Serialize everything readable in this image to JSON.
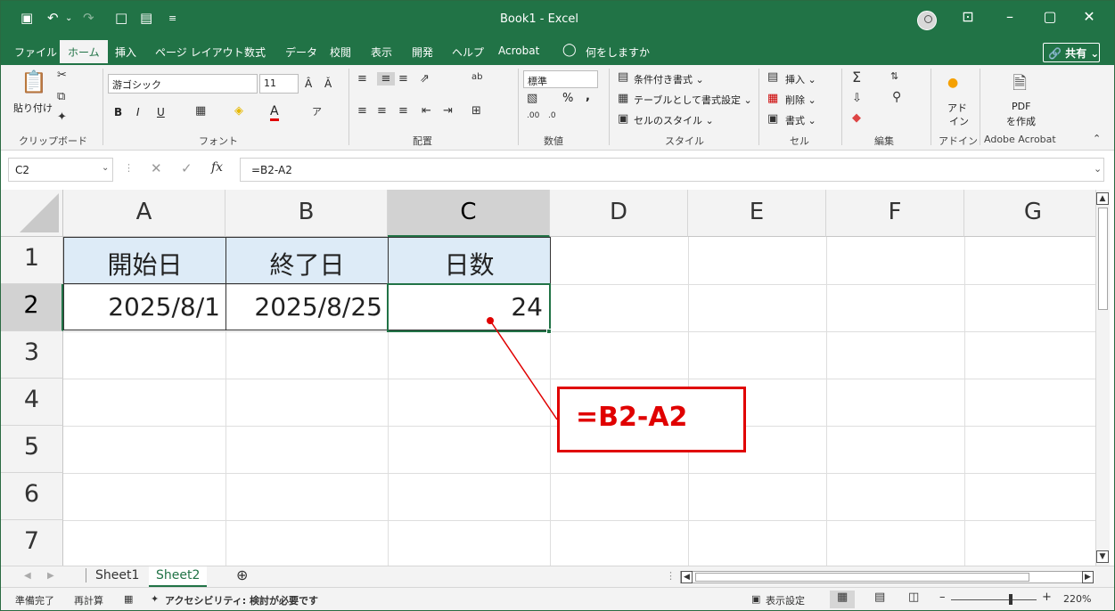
{
  "titlebar": {
    "title": "Book1  -  Excel",
    "qat": [
      "💾",
      "↶",
      "↷",
      "🗋",
      "▦",
      "="
    ],
    "minimize": "–",
    "restore": "▢",
    "close": "✕",
    "ribbon_display": "⊡"
  },
  "tabs": [
    "ファイル",
    "ホーム",
    "挿入",
    "ページ レイアウト",
    "数式",
    "データ",
    "校閲",
    "表示",
    "開発",
    "ヘルプ",
    "Acrobat"
  ],
  "tellme": "何をしますか",
  "share_label": "🔗 共有 ⌄",
  "ribbon": {
    "clipboard": {
      "paste": "貼り付け",
      "group": "クリップボード"
    },
    "font": {
      "name": "游ゴシック",
      "size": "11",
      "group": "フォント",
      "bold": "B",
      "italic": "I",
      "underline": "U",
      "grow": "A^",
      "shrink": "A˅"
    },
    "alignment": {
      "group": "配置"
    },
    "number": {
      "format": "標準",
      "percent": "%",
      "comma": ",",
      "group": "数値"
    },
    "styles": {
      "conditional": "条件付き書式 ⌄",
      "table": "テーブルとして書式設定 ⌄",
      "cellstyle": "セルのスタイル ⌄",
      "group": "スタイル"
    },
    "cells": {
      "insert": "挿入 ⌄",
      "delete": "削除 ⌄",
      "format": "書式 ⌄",
      "group": "セル"
    },
    "editing": {
      "group": "編集"
    },
    "addins": {
      "label1": "アド",
      "label2": "イン",
      "group": "アドイン"
    },
    "acrobat": {
      "label1": "PDF",
      "label2": "を作成",
      "group": "Adobe Acrobat"
    }
  },
  "formula_bar": {
    "name_box": "C2",
    "cancel": "✕",
    "enter": "✓",
    "fx": "fx",
    "formula": "=B2-A2"
  },
  "columns": [
    "A",
    "B",
    "C",
    "D",
    "E",
    "F",
    "G"
  ],
  "rows": [
    "1",
    "2",
    "3",
    "4",
    "5",
    "6",
    "7"
  ],
  "cells": {
    "A1": "開始日",
    "B1": "終了日",
    "C1": "日数",
    "A2": "2025/8/1",
    "B2": "2025/8/25",
    "C2": "24"
  },
  "callout_text": "=B2-A2",
  "sheets": [
    "Sheet1",
    "Sheet2"
  ],
  "add_sheet": "⊕",
  "status": {
    "ready": "準備完了",
    "recalc": "再計算",
    "accessibility": "アクセシビリティ: 検討が必要です",
    "display_settings": "表示設定",
    "zoom_minus": "–",
    "zoom_plus": "+",
    "zoom": "220%"
  },
  "colors": {
    "excel_green": "#217346",
    "header_fill": "#ddebf7",
    "callout_red": "#e00000"
  }
}
